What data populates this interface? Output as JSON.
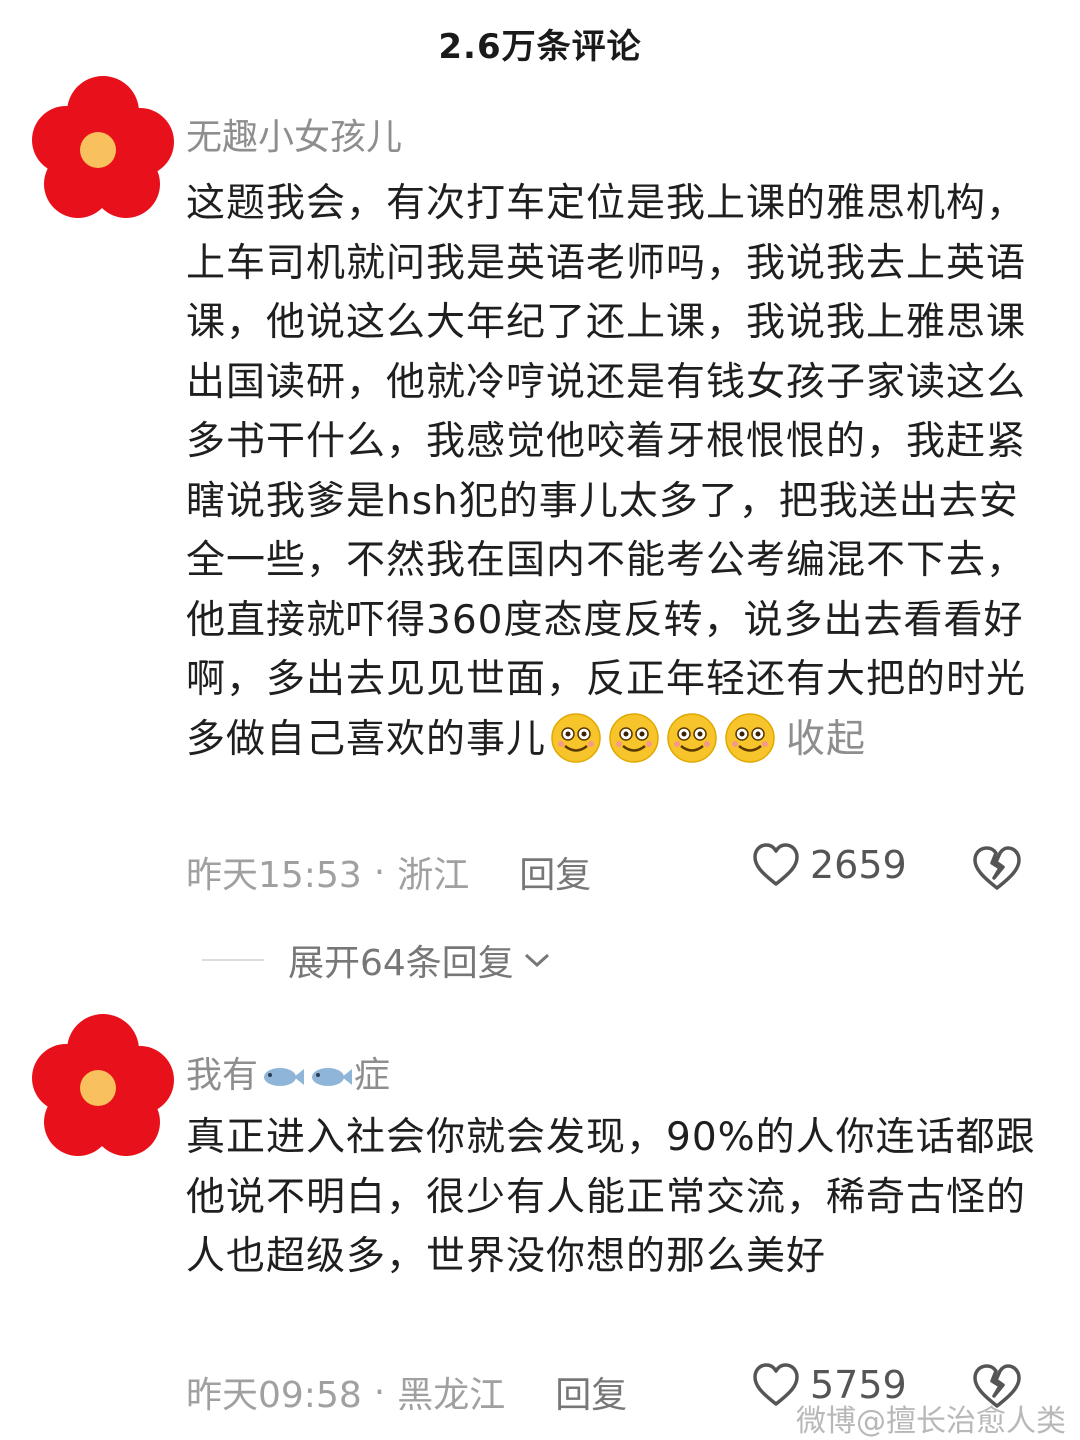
{
  "header": {
    "title": "2.6万条评论"
  },
  "comments": [
    {
      "username": "无趣小女孩儿",
      "text": "这题我会，有次打车定位是我上课的雅思机构，上车司机就问我是英语老师吗，我说我去上英语课，他说这么大年纪了还上课，我说我上雅思课出国读研，他就冷哼说还是有钱女孩子家读这么多书干什么，我感觉他咬着牙根恨恨的，我赶紧瞎说我爹是hsh犯的事儿太多了，把我送出去安全一些，不然我在国内不能考公考编混不下去，他直接就吓得360度态度反转，说多出去看看好啊，多出去见见世面，反正年轻还有大把的时光多做自己喜欢的事儿",
      "emoji_icons": [
        "smile-emoji-icon",
        "smile-emoji-icon",
        "smile-emoji-icon",
        "smile-emoji-icon"
      ],
      "collapse_label": "收起",
      "time": "昨天15:53",
      "separator": "·",
      "location": "浙江",
      "reply_label": "回复",
      "likes": "2659",
      "expand_replies_label": "展开64条回复"
    },
    {
      "username_prefix": "我有",
      "username_suffix": "症",
      "username_icons": [
        "fish-icon",
        "fish-icon"
      ],
      "text": "真正进入社会你就会发现，90%的人你连话都跟他说不明白，很少有人能正常交流，稀奇古怪的人也超级多，世界没你想的那么美好",
      "time": "昨天09:58",
      "separator": "·",
      "location": "黑龙江",
      "reply_label": "回复",
      "likes": "5759"
    }
  ],
  "watermark": "微博@擅长治愈人类",
  "colors": {
    "avatar_petal": "#e8101a",
    "avatar_center": "#f8c15e",
    "meta_gray": "#a0a0a0",
    "text": "#1f1f1f"
  }
}
